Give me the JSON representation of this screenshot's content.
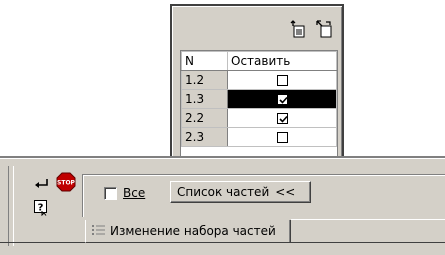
{
  "popup": {
    "toolbar": {
      "buttons": [
        {
          "icon": "sheet-up-arrow-icon"
        },
        {
          "icon": "sheet-corner-arrow-icon"
        }
      ]
    },
    "table": {
      "headers": [
        "N",
        "Оставить"
      ],
      "rows": [
        {
          "n": "1.2",
          "keep": false,
          "selected": false
        },
        {
          "n": "1.3",
          "keep": true,
          "selected": true
        },
        {
          "n": "2.2",
          "keep": true,
          "selected": false
        },
        {
          "n": "2.3",
          "keep": false,
          "selected": false
        }
      ]
    }
  },
  "panel": {
    "left_icons": [
      "enter-arrow-icon",
      "stop-icon",
      "help-icon"
    ],
    "all_checkbox": {
      "label": "Все",
      "checked": false
    },
    "list_button": {
      "label": "Список частей",
      "chevron": "<<"
    },
    "tab": {
      "label": "Изменение набора частей",
      "icon": "list-icon"
    }
  },
  "colors": {
    "face": "#d4d0c8",
    "shadow": "#808080",
    "dark": "#404040",
    "stop_red": "#c00000"
  }
}
